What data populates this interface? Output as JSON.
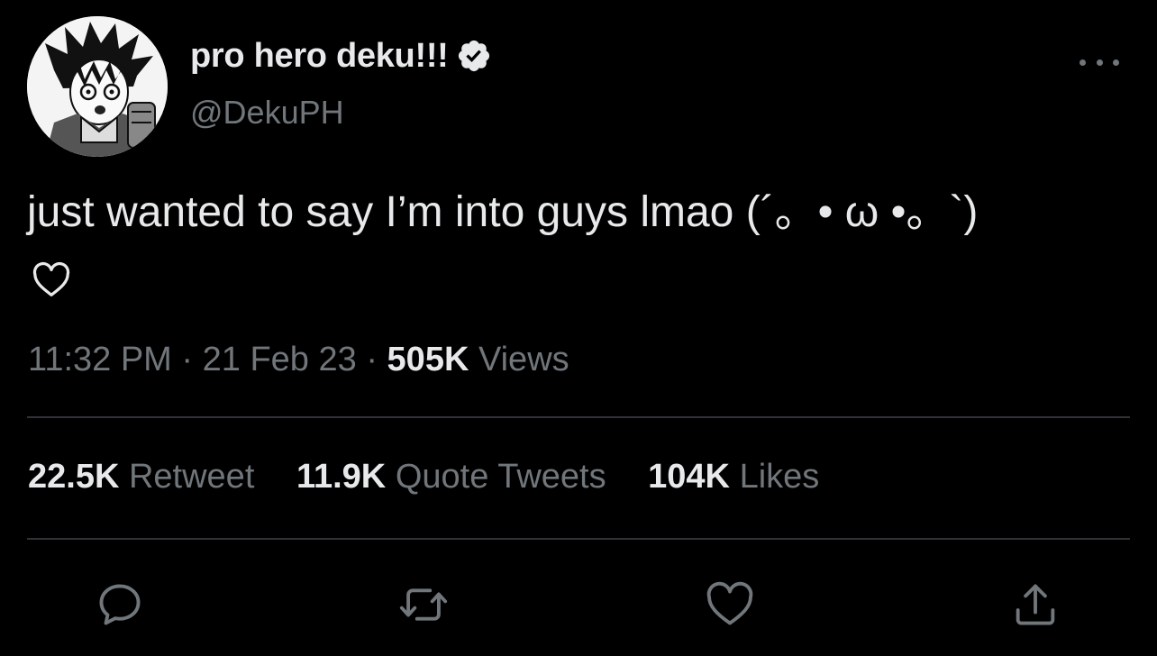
{
  "tweet": {
    "display_name": "pro hero deku!!!",
    "handle": "@DekuPH",
    "text": "just wanted to say I’m into guys lmao (´。• ω •。`)",
    "time": "11:32 PM",
    "separator": "·",
    "date": "21 Feb 23",
    "views_count": "505K",
    "views_label": "Views"
  },
  "stats": {
    "retweets_count": "22.5K",
    "retweets_label": "Retweet",
    "quotes_count": "11.9K",
    "quotes_label": "Quote Tweets",
    "likes_count": "104K",
    "likes_label": "Likes"
  },
  "icons": {
    "verified": "verified-badge-icon",
    "more": "more-options-icon",
    "heart_in_text": "heart-outline-icon",
    "reply": "reply-bubble-icon",
    "retweet": "retweet-icon",
    "like": "like-heart-icon",
    "share": "share-upload-icon"
  },
  "colors": {
    "background": "#000000",
    "primary_text": "#e7e9ea",
    "secondary_text": "#71767b",
    "divider": "#2f3336",
    "verified_badge": "#e7e9ea"
  }
}
